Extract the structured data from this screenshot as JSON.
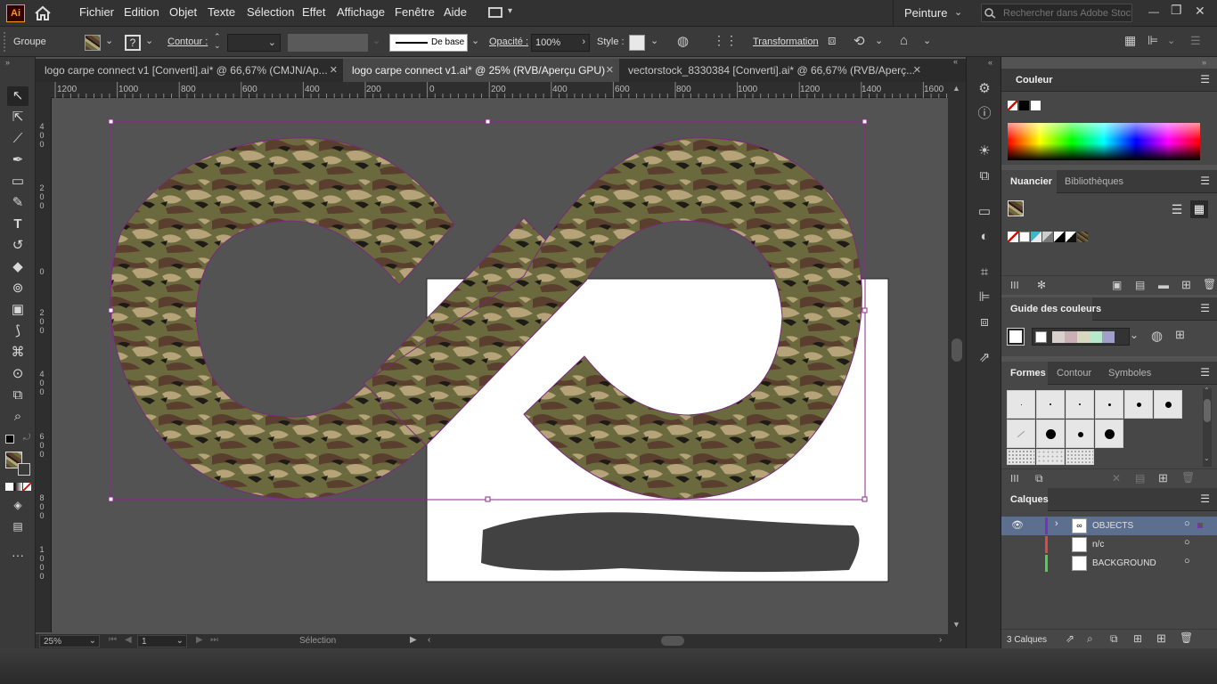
{
  "app": {
    "logo": "Ai"
  },
  "menu": {
    "items": [
      "Fichier",
      "Edition",
      "Objet",
      "Texte",
      "Sélection",
      "Effet",
      "Affichage",
      "Fenêtre",
      "Aide"
    ],
    "workspace": "Peinture",
    "search_placeholder": "Rechercher dans Adobe Stock"
  },
  "control": {
    "selection_type": "Groupe",
    "stroke_label": "Contour :",
    "stroke_profile": "De base",
    "opacity_label": "Opacité :",
    "opacity_value": "100%",
    "style_label": "Style :",
    "transform_label": "Transformation"
  },
  "tabs": [
    {
      "label": "logo carpe connect v1 [Converti].ai* @ 66,67% (CMJN/Ap...",
      "active": false
    },
    {
      "label": "logo carpe connect v1.ai* @ 25% (RVB/Aperçu GPU)",
      "active": true
    },
    {
      "label": "vectorstock_8330384 [Converti].ai* @ 66,67% (RVB/Aperç...",
      "active": false
    }
  ],
  "ruler": {
    "horizontal": [
      "1200",
      "1000",
      "800",
      "600",
      "400",
      "200",
      "0",
      "200",
      "400",
      "600",
      "800",
      "1000",
      "1200",
      "1400",
      "1600"
    ],
    "vertical": [
      "400",
      "200",
      "0",
      "200",
      "400",
      "600",
      "800",
      "1000"
    ]
  },
  "status": {
    "zoom": "25%",
    "artboard": "1",
    "tool": "Sélection"
  },
  "panels": {
    "color": {
      "title": "Couleur"
    },
    "swatches": {
      "tabs": [
        "Nuancier",
        "Bibliothèques"
      ]
    },
    "guide": {
      "title": "Guide des couleurs"
    },
    "brushes": {
      "tabs": [
        "Formes",
        "Contour",
        "Symboles"
      ]
    },
    "layers": {
      "title": "Calques",
      "items": [
        {
          "name": "OBJECTS",
          "color": "#7b2fbf"
        },
        {
          "name": "n/c",
          "color": "#e04848"
        },
        {
          "name": "BACKGROUND",
          "color": "#4fd04f"
        }
      ],
      "count": "3 Calques"
    }
  },
  "colors": {
    "selection": "#8a2a8a",
    "camo": [
      "#6b6a3e",
      "#5a3e2e",
      "#b6a37a",
      "#1e1a16"
    ]
  },
  "icons": {
    "home": "home-icon",
    "search": "search-icon",
    "menu": "panel-menu-icon",
    "eye": "eye-icon"
  }
}
